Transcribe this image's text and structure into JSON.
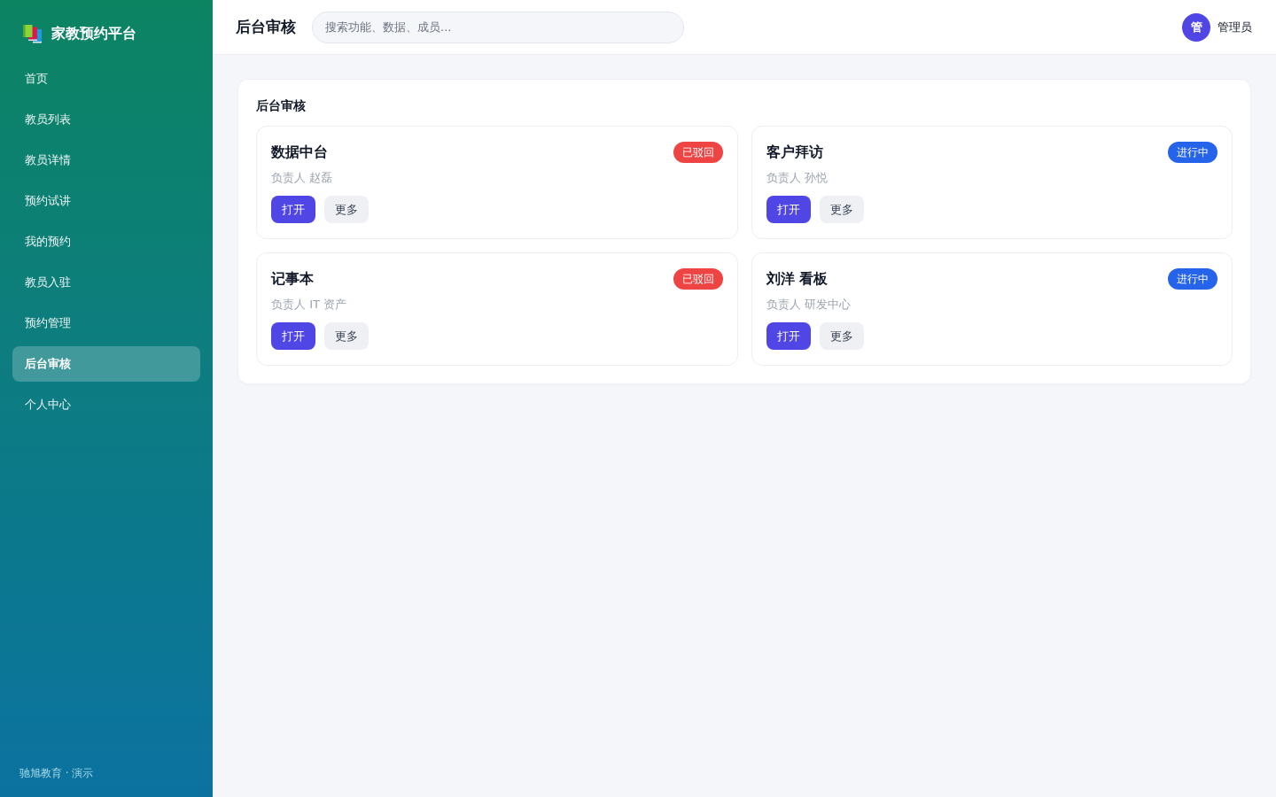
{
  "sidebar": {
    "brand": "家教预约平台",
    "items": [
      {
        "label": "首页",
        "selected": false
      },
      {
        "label": "教员列表",
        "selected": false
      },
      {
        "label": "教员详情",
        "selected": false
      },
      {
        "label": "预约试讲",
        "selected": false
      },
      {
        "label": "我的预约",
        "selected": false
      },
      {
        "label": "教员入驻",
        "selected": false
      },
      {
        "label": "预约管理",
        "selected": false
      },
      {
        "label": "后台审核",
        "selected": true
      },
      {
        "label": "个人中心",
        "selected": false
      }
    ],
    "footer": "驰旭教育 · 演示"
  },
  "header": {
    "title": "后台审核",
    "search": {
      "placeholder": "搜索功能、数据、成员..."
    },
    "user": {
      "avatar": "管",
      "name": "管理员"
    }
  },
  "panel": {
    "title": "后台审核",
    "cards": [
      {
        "title": "数据中台",
        "badge": {
          "label": "已驳回",
          "color": "#ef4444"
        },
        "owner": "负责人 赵磊",
        "buttons": [
          {
            "label": "打开",
            "kind": "primary"
          },
          {
            "label": "更多",
            "kind": "secondary"
          }
        ]
      },
      {
        "title": "客户拜访",
        "badge": {
          "label": "进行中",
          "color": "#2563eb"
        },
        "owner": "负责人 孙悦",
        "buttons": [
          {
            "label": "打开",
            "kind": "primary"
          },
          {
            "label": "更多",
            "kind": "secondary"
          }
        ]
      },
      {
        "title": "记事本",
        "badge": {
          "label": "已驳回",
          "color": "#ef4444"
        },
        "owner": "负责人 IT 资产",
        "buttons": [
          {
            "label": "打开",
            "kind": "primary"
          },
          {
            "label": "更多",
            "kind": "secondary"
          }
        ]
      },
      {
        "title": "刘洋 看板",
        "badge": {
          "label": "进行中",
          "color": "#2563eb"
        },
        "owner": "负责人 研发中心",
        "buttons": [
          {
            "label": "打开",
            "kind": "primary"
          },
          {
            "label": "更多",
            "kind": "secondary"
          }
        ]
      }
    ]
  }
}
